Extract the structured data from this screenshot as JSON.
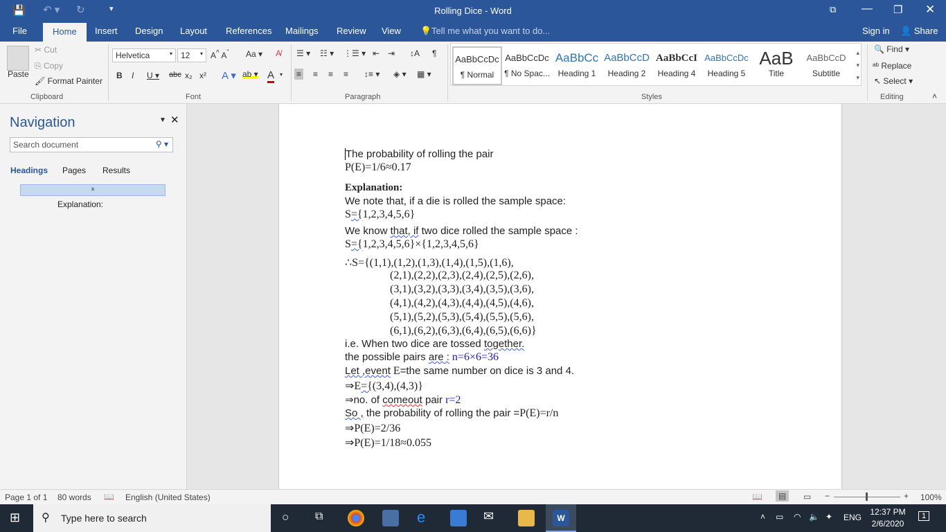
{
  "window": {
    "title": "Rolling Dice - Word"
  },
  "tabs": [
    "File",
    "Home",
    "Insert",
    "Design",
    "Layout",
    "References",
    "Mailings",
    "Review",
    "View"
  ],
  "tell_me": "Tell me what you want to do...",
  "sign_in": "Sign in",
  "share": "Share",
  "clipboard": {
    "paste": "Paste",
    "cut": "Cut",
    "copy": "Copy",
    "format_painter": "Format Painter",
    "label": "Clipboard"
  },
  "font": {
    "name": "Helvetica",
    "size": "12",
    "label": "Font"
  },
  "paragraph": {
    "label": "Paragraph"
  },
  "styles": {
    "label": "Styles",
    "items": [
      {
        "preview": "AaBbCcDc",
        "name": "¶ Normal"
      },
      {
        "preview": "AaBbCcDc",
        "name": "¶ No Spac..."
      },
      {
        "preview": "AaBbCc",
        "name": "Heading 1"
      },
      {
        "preview": "AaBbCcD",
        "name": "Heading 2"
      },
      {
        "preview": "AaBbCcI",
        "name": "Heading 4"
      },
      {
        "preview": "AaBbCcDc",
        "name": "Heading 5"
      },
      {
        "preview": "AaB",
        "name": "Title"
      },
      {
        "preview": "AaBbCcD",
        "name": "Subtitle"
      }
    ]
  },
  "editing": {
    "find": "Find",
    "replace": "Replace",
    "select": "Select",
    "label": "Editing"
  },
  "navigation": {
    "title": "Navigation",
    "search_placeholder": "Search document",
    "tabs": [
      "Headings",
      "Pages",
      "Results"
    ],
    "heading_item": "Explanation:"
  },
  "document": {
    "l1": "The probability of rolling the pair",
    "l2": "P(E)=1/6≈0.17",
    "l3": "Explanation:",
    "l4": "We note that, if a die is rolled the sample space:",
    "l5a": "S",
    "l5b": "={",
    "l5c": "1,2,3,4,5,6}",
    "l6a": "We know ",
    "l6b": "that, if",
    "l6c": " two dice rolled the sample space :",
    "l7a": "S",
    "l7b": "={",
    "l7c": "1,2,3,4,5,6}×{1,2,3,4,5,6}",
    "matrix": [
      "∴S={(1,1),(1,2),(1,3),(1,4),(1,5),(1,6),",
      "(2,1),(2,2),(2,3),(2,4),(2,5),(2,6),",
      "(3,1),(3,2),(3,3),(3,4),(3,5),(3,6),",
      "(4,1),(4,2),(4,3),(4,4),(4,5),(4,6),",
      "(5,1),(5,2),(5,3),(5,4),(5,5),(5,6),",
      "(6,1),(6,2),(6,3),(6,4),(6,5),(6,6)}"
    ],
    "l8a": "i.e. When two dice are tossed ",
    "l8b": "together.",
    "l9a": "the possible pairs ",
    "l9b": "are :",
    "l9c": " n=6×6=36",
    "l10a": "Let ,event",
    "l10b": " E",
    "l10c": "=the same number on dice is 3 and 4.",
    "l11a": "⇒E",
    "l11b": "={",
    "l11c": "(3,4),(4,3)}",
    "l12a": "⇒no. of ",
    "l12b": "comeout",
    "l12c": " pair ",
    "l12d": "r=2",
    "l13a": "So ,",
    "l13b": " the probability of rolling the pair =",
    "l13c": "P(E)=r/n",
    "l14": "⇒P(E)=2/36",
    "l15": "⇒P(E)=1/18≈0.055"
  },
  "status": {
    "page": "Page 1 of 1",
    "words": "80 words",
    "language": "English (United States)",
    "zoom": "100%"
  },
  "taskbar": {
    "search": "Type here to search",
    "lang": "ENG",
    "time": "12:37 PM",
    "date": "2/6/2020",
    "notifications": "1"
  }
}
